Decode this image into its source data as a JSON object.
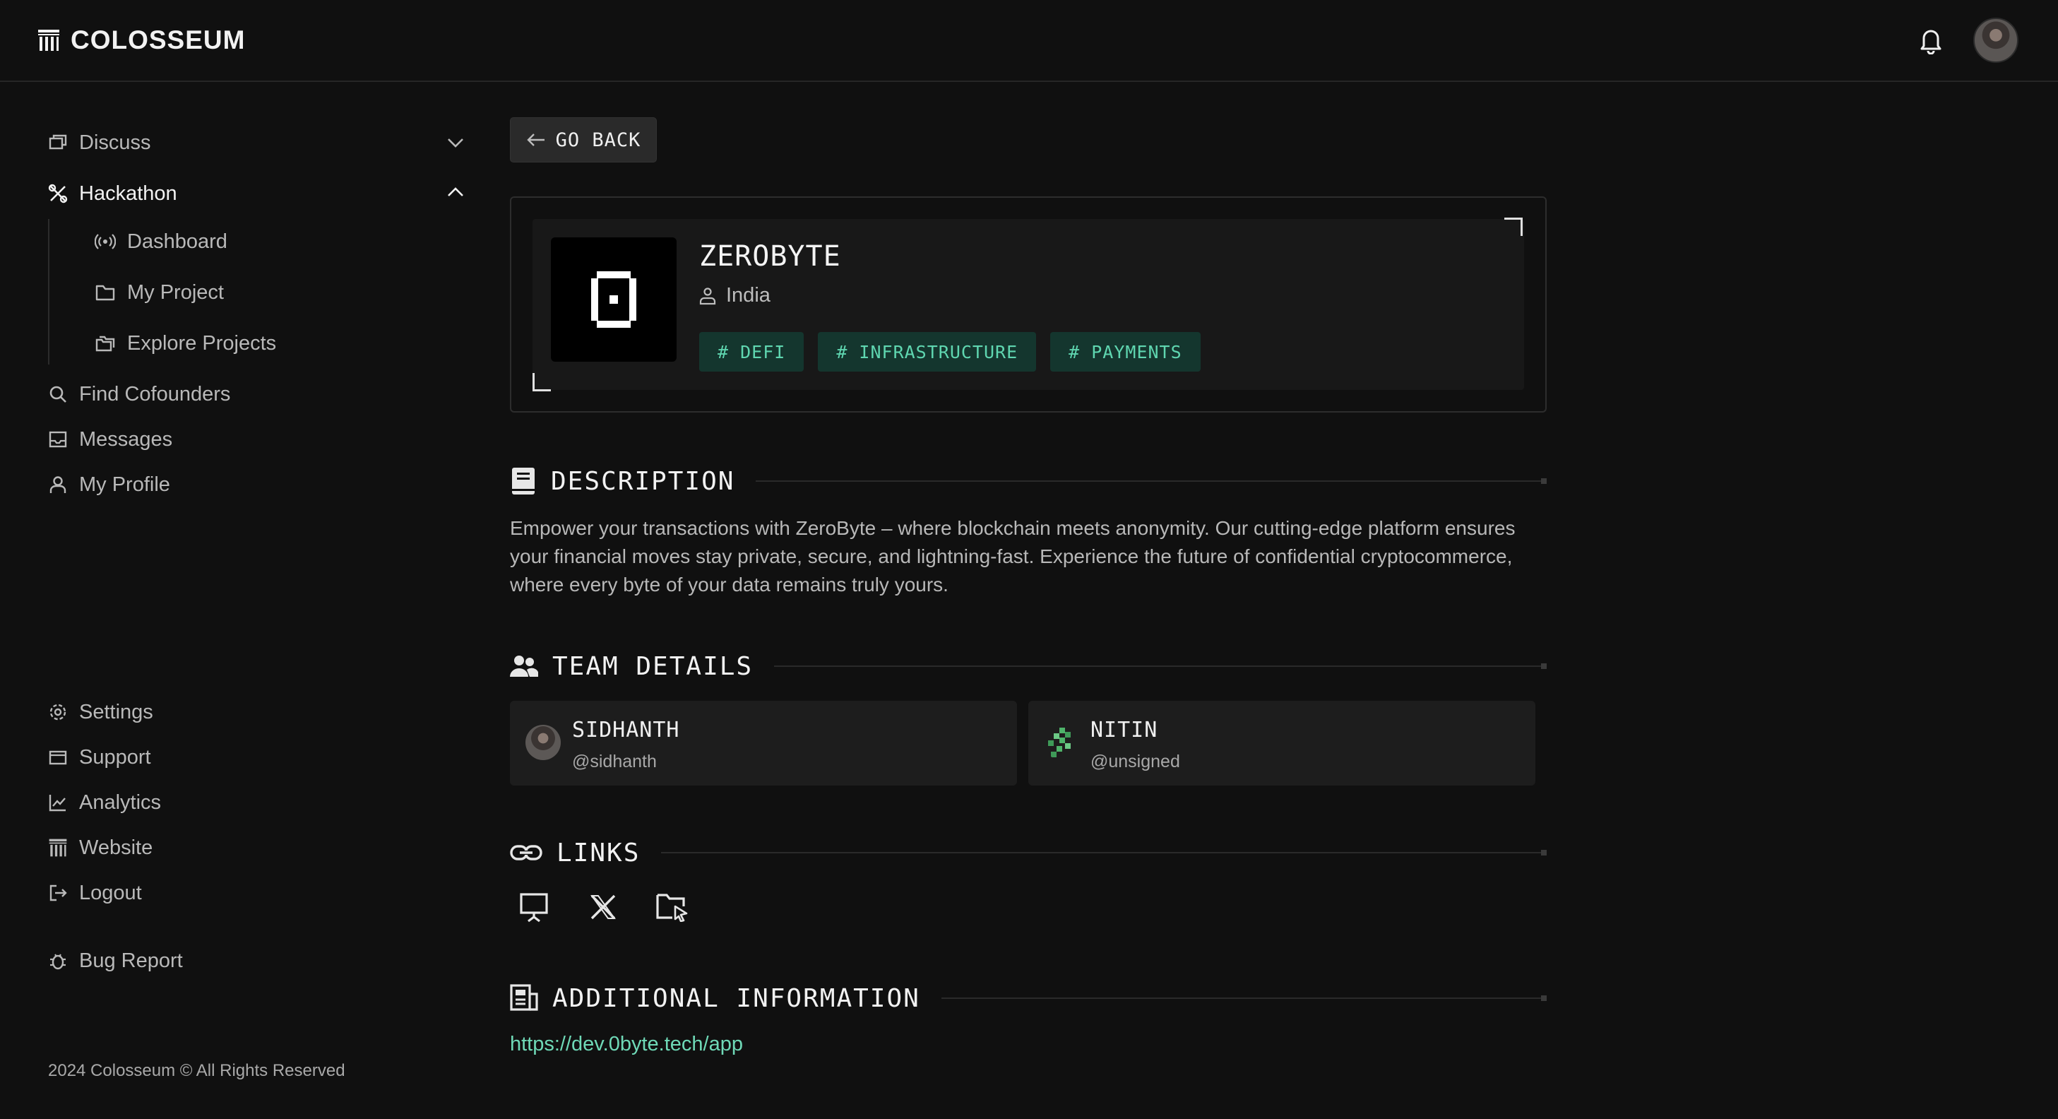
{
  "header": {
    "brand": "COLOSSEUM",
    "bell_icon": "bell-icon",
    "avatar_icon": "user-avatar"
  },
  "sidebar": {
    "items": [
      {
        "label": "Discuss",
        "icon": "chat-icon"
      },
      {
        "label": "Hackathon",
        "icon": "tools-icon"
      },
      {
        "label": "Dashboard",
        "icon": "broadcast-icon"
      },
      {
        "label": "My Project",
        "icon": "folder-icon"
      },
      {
        "label": "Explore Projects",
        "icon": "folders-icon"
      },
      {
        "label": "Find Cofounders",
        "icon": "search-icon"
      },
      {
        "label": "Messages",
        "icon": "inbox-icon"
      },
      {
        "label": "My Profile",
        "icon": "user-icon"
      }
    ],
    "bottom_items": [
      {
        "label": "Settings",
        "icon": "gear-icon"
      },
      {
        "label": "Support",
        "icon": "mail-icon"
      },
      {
        "label": "Analytics",
        "icon": "chart-icon"
      },
      {
        "label": "Website",
        "icon": "colosseum-icon"
      },
      {
        "label": "Logout",
        "icon": "logout-icon"
      },
      {
        "label": "Bug Report",
        "icon": "bug-icon"
      }
    ],
    "footer": "2024 Colosseum © All Rights Reserved"
  },
  "main": {
    "go_back": "GO BACK",
    "project": {
      "name": "ZEROBYTE",
      "location": "India",
      "tags": [
        "# DEFI",
        "# INFRASTRUCTURE",
        "# PAYMENTS"
      ],
      "accent_color": "#5fd6b0"
    },
    "sections": {
      "description_title": "DESCRIPTION",
      "team_title": "TEAM DETAILS",
      "links_title": "LINKS",
      "additional_title": "ADDITIONAL INFORMATION"
    },
    "description": "Empower your transactions with ZeroByte – where blockchain meets anonymity. Our cutting-edge platform ensures your financial moves stay private, secure, and lightning-fast. Experience the future of confidential cryptocommerce, where every byte of your data remains truly yours.",
    "team": [
      {
        "name": "SIDHANTH",
        "handle": "@sidhanth"
      },
      {
        "name": "NITIN",
        "handle": "@unsigned"
      }
    ],
    "links": [
      "presentation-icon",
      "x-icon",
      "folder-cursor-icon"
    ],
    "additional_link": "https://dev.0byte.tech/app"
  }
}
